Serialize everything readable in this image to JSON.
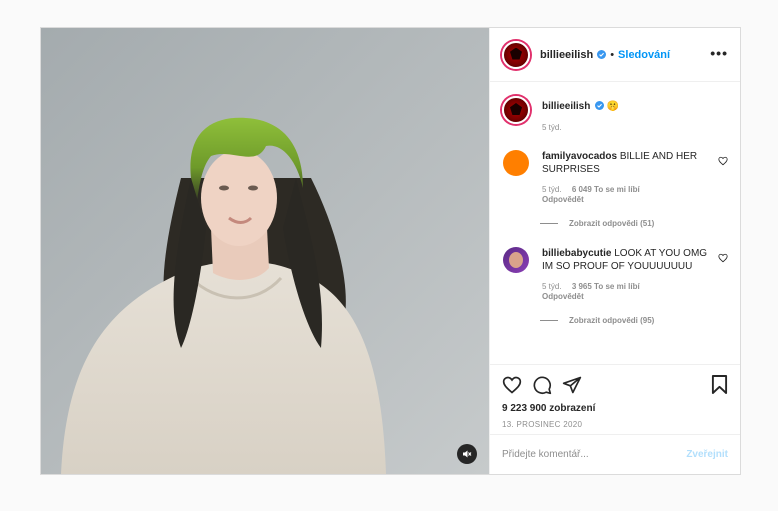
{
  "post": {
    "author": {
      "username": "billieeilish",
      "follow_label": "Sledování",
      "separator": "•"
    },
    "caption": {
      "username": "billieeilish",
      "emoji": "🤫",
      "time": "5 týd."
    },
    "comments": [
      {
        "username": "familyavocados",
        "text": "BILLIE AND HER SURPRISES",
        "time": "5 týd.",
        "likes": "6 049 To se mi líbí",
        "reply_label": "Odpovědět",
        "view_replies": "Zobrazit odpovědi (51)"
      },
      {
        "username": "billiebabycutie",
        "text": "LOOK AT YOU OMG IM SO PROUF OF YOUUUUUUU",
        "time": "5 týd.",
        "likes": "3 965 To se mi líbí",
        "reply_label": "Odpovědět",
        "view_replies": "Zobrazit odpovědi (95)"
      }
    ],
    "views": "9 223 900 zobrazení",
    "date": "13. PROSINEC 2020",
    "comment_placeholder": "Přidejte komentář...",
    "post_button": "Zveřejnit"
  },
  "icons": {
    "like": "heart-icon",
    "comment": "comment-icon",
    "share": "paper-plane-icon",
    "save": "bookmark-icon",
    "mute": "muted-speaker-icon",
    "verified": "verified-badge-icon",
    "more": "more-options-icon"
  },
  "colors": {
    "accent": "#0095f6",
    "post_disabled": "#b2dffc",
    "muted_text": "#8e8e8e",
    "border": "#dbdbdb"
  }
}
